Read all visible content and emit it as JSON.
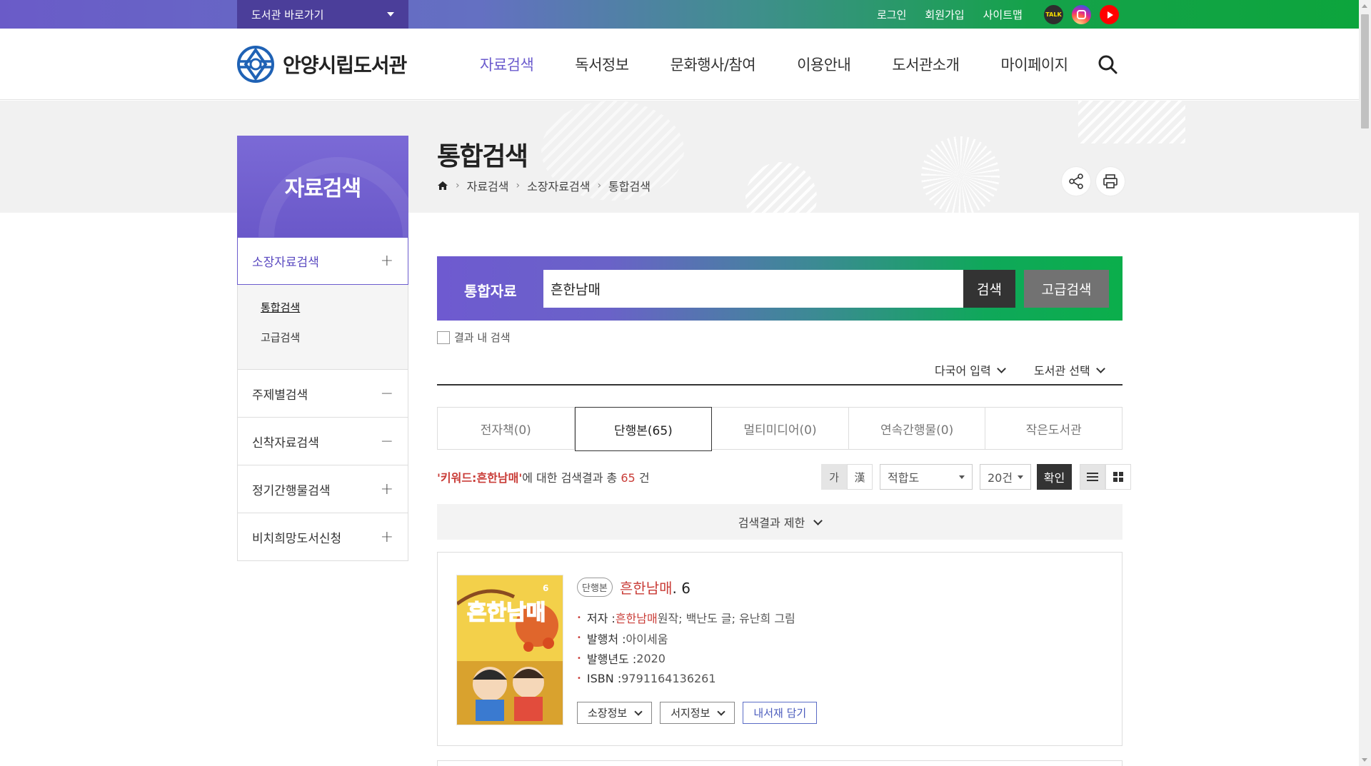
{
  "topbar": {
    "quick_link": "도서관 바로가기",
    "links": [
      "로그인",
      "회원가입",
      "사이트맵"
    ],
    "sns": [
      "TALK"
    ]
  },
  "header": {
    "logo_text": "안양시립도서관",
    "nav": [
      "자료검색",
      "독서정보",
      "문화행사/참여",
      "이용안내",
      "도서관소개",
      "마이페이지"
    ]
  },
  "lnb": {
    "title": "자료검색",
    "items": [
      {
        "label": "소장자료검색",
        "toggle": "+"
      },
      {
        "label": "주제별검색",
        "toggle": "−"
      },
      {
        "label": "신착자료검색",
        "toggle": "−"
      },
      {
        "label": "정기간행물검색",
        "toggle": "+"
      },
      {
        "label": "비치희망도서신청",
        "toggle": "+"
      }
    ],
    "sub_items": [
      "통합검색",
      "고급검색"
    ]
  },
  "page": {
    "title": "통합검색",
    "breadcrumb": [
      "자료검색",
      "소장자료검색",
      "통합검색"
    ]
  },
  "search": {
    "label": "통합자료",
    "query": "흔한남매",
    "search_button": "검색",
    "advanced_button": "고급검색",
    "within_label": "결과 내 검색",
    "multilang": "다국어 입력",
    "library_select": "도서관 선택"
  },
  "tabs": [
    "전자책(0)",
    "단행본(65)",
    "멀티미디어(0)",
    "연속간행물(0)",
    "작은도서관"
  ],
  "results": {
    "keyword_text": "'키워드:흔한남매'",
    "suffix_text": "에 대한 검색결과 총",
    "count": "65",
    "unit": "건",
    "lang_options": [
      "가",
      "漢"
    ],
    "sort": "적합도",
    "per_page": "20건",
    "confirm": "확인",
    "limit_label": "검색결과 제한"
  },
  "book": {
    "type": "단행본",
    "title_hl": "흔한남매",
    "title_rest": ". 6",
    "author_label": "저자 : ",
    "author_hl": "흔한남매",
    "author_rest": " 원작; 백난도 글; 유난희 그림",
    "publisher_label": "발행처 : ",
    "publisher": "아이세움",
    "year_label": "발행년도 : ",
    "year": "2020",
    "isbn_label": "ISBN : ",
    "isbn": "9791164136261",
    "btn_holding": "소장정보",
    "btn_biblio": "서지정보",
    "btn_shelf": "내서재 담기",
    "cover_title": "흔한남매",
    "cover_volume": "6"
  },
  "colors": {
    "accent_purple": "#6b5bcd",
    "accent_green": "#0ca53c",
    "highlight_red": "#c93c37"
  }
}
